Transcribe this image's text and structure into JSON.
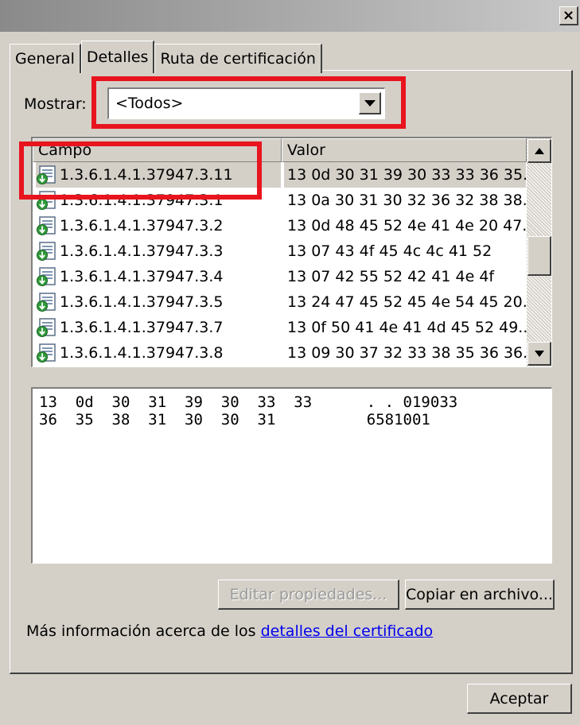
{
  "titlebar": {
    "close_label": "×"
  },
  "tabs": [
    {
      "label": "General"
    },
    {
      "label": "Detalles"
    },
    {
      "label": "Ruta de certificación"
    }
  ],
  "show": {
    "label": "Mostrar:",
    "selected": "<Todos>"
  },
  "list": {
    "columns": [
      "Campo",
      "Valor"
    ],
    "rows": [
      {
        "field": "1.3.6.1.4.1.37947.3.11",
        "value": "13 0d 30 31 39 30 33 33 36 35..."
      },
      {
        "field": "1.3.6.1.4.1.37947.3.1",
        "value": "13 0a 30 31 30 32 36 32 38 38..."
      },
      {
        "field": "1.3.6.1.4.1.37947.3.2",
        "value": "13 0d 48 45 52 4e 41 4e 20 47..."
      },
      {
        "field": "1.3.6.1.4.1.37947.3.3",
        "value": "13 07 43 4f 45 4c 4c 41 52"
      },
      {
        "field": "1.3.6.1.4.1.37947.3.4",
        "value": "13 07 42 55 52 42 41 4e 4f"
      },
      {
        "field": "1.3.6.1.4.1.37947.3.5",
        "value": "13 24 47 45 52 45 4e 54 45 20..."
      },
      {
        "field": "1.3.6.1.4.1.37947.3.7",
        "value": "13 0f 50 41 4e 41 4d 45 52 49..."
      },
      {
        "field": "1.3.6.1.4.1.37947.3.8",
        "value": "13 09 30 37 32 33 38 35 36 36..."
      }
    ]
  },
  "hex": {
    "lines": [
      "13  0d  30  31  39  30  33  33      . . 019033",
      "36  35  38  31  30  30  31          6581001"
    ]
  },
  "buttons": {
    "edit": "Editar propiedades...",
    "copy": "Copiar en archivo...",
    "ok": "Aceptar"
  },
  "info": {
    "text": "Más información acerca de los ",
    "link": "detalles del certificado"
  },
  "colors": {
    "highlight": "#e8141e",
    "dialog": "#d4d0c8",
    "link": "#0000ee"
  }
}
